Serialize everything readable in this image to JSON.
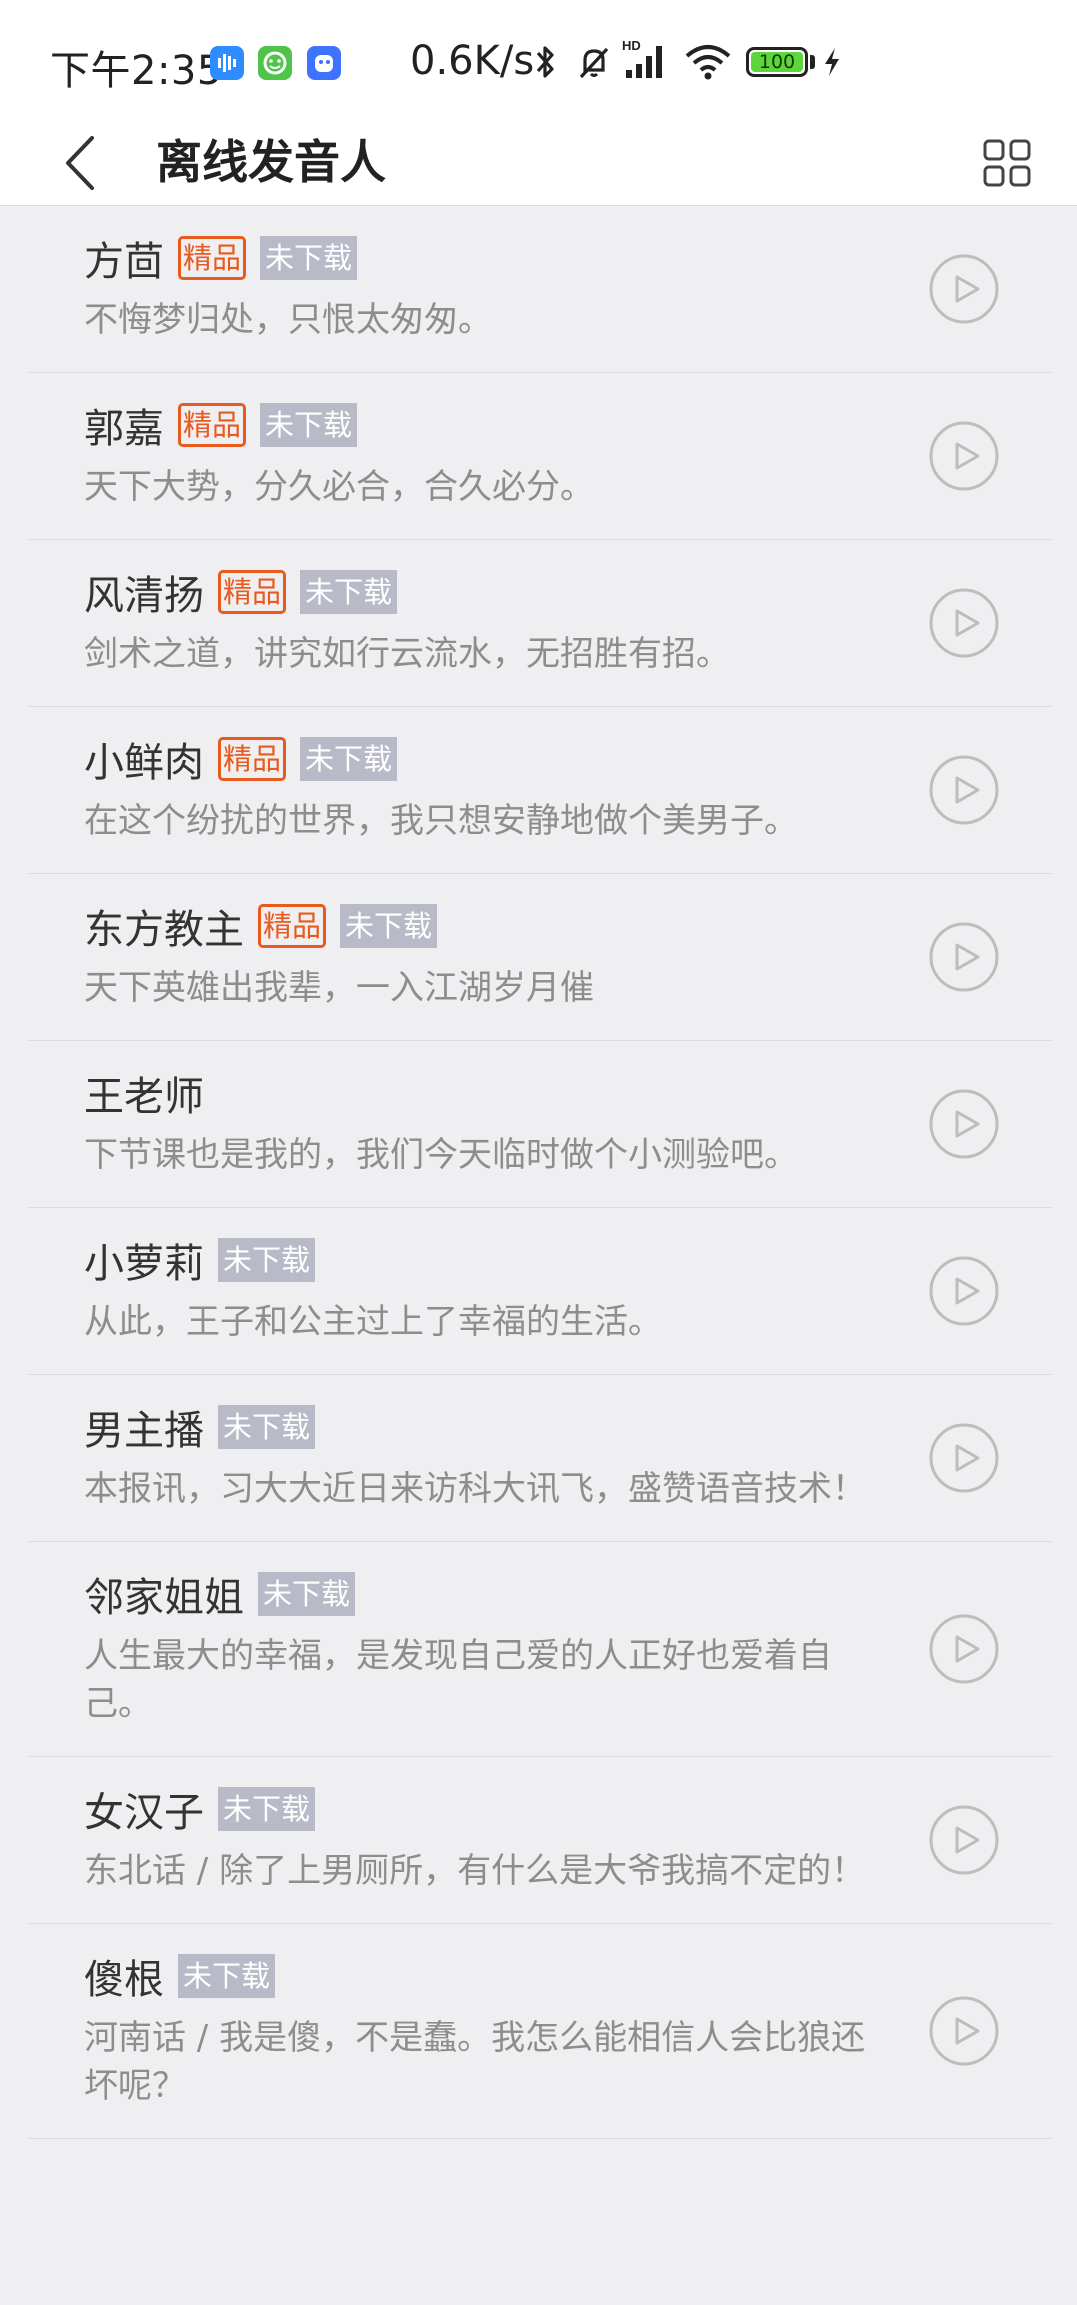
{
  "status_bar": {
    "time": "下午2:35",
    "net_speed": "0.6K/s",
    "signal_label": "HD",
    "battery_level": "100",
    "icons": [
      "voice-app-icon",
      "chat-app-icon",
      "assistant-app-icon",
      "bluetooth-icon",
      "mute-bell-icon",
      "signal-icon",
      "wifi-icon",
      "battery-icon",
      "charging-icon"
    ]
  },
  "header": {
    "title": "离线发音人",
    "back_icon": "chevron-left-icon",
    "grid_icon": "grid-view-icon"
  },
  "colors": {
    "premium": "#e85a1e",
    "not_downloaded_bg": "#b8bbc7",
    "background": "#efeff1",
    "desc_text": "#8d8d8d"
  },
  "voices": [
    {
      "name": "方茴",
      "premium": "精品",
      "status": "未下载",
      "desc": "不悔梦归处，只恨太匆匆。"
    },
    {
      "name": "郭嘉",
      "premium": "精品",
      "status": "未下载",
      "desc": "天下大势，分久必合，合久必分。"
    },
    {
      "name": "风清扬",
      "premium": "精品",
      "status": "未下载",
      "desc": "剑术之道，讲究如行云流水，无招胜有招。"
    },
    {
      "name": "小鲜肉",
      "premium": "精品",
      "status": "未下载",
      "desc": "在这个纷扰的世界，我只想安静地做个美男子。"
    },
    {
      "name": "东方教主",
      "premium": "精品",
      "status": "未下载",
      "desc": "天下英雄出我辈，一入江湖岁月催"
    },
    {
      "name": "王老师",
      "premium": "",
      "status": "",
      "desc": "下节课也是我的，我们今天临时做个小测验吧。"
    },
    {
      "name": "小萝莉",
      "premium": "",
      "status": "未下载",
      "desc": "从此，王子和公主过上了幸福的生活。"
    },
    {
      "name": "男主播",
      "premium": "",
      "status": "未下载",
      "desc": "本报讯，习大大近日来访科大讯飞，盛赞语音技术！"
    },
    {
      "name": "邻家姐姐",
      "premium": "",
      "status": "未下载",
      "desc": "人生最大的幸福，是发现自己爱的人正好也爱着自己。"
    },
    {
      "name": "女汉子",
      "premium": "",
      "status": "未下载",
      "desc": "东北话 / 除了上男厕所，有什么是大爷我搞不定的！"
    },
    {
      "name": "傻根",
      "premium": "",
      "status": "未下载",
      "desc": "河南话 / 我是傻，不是蠢。我怎么能相信人会比狼还坏呢？"
    }
  ]
}
